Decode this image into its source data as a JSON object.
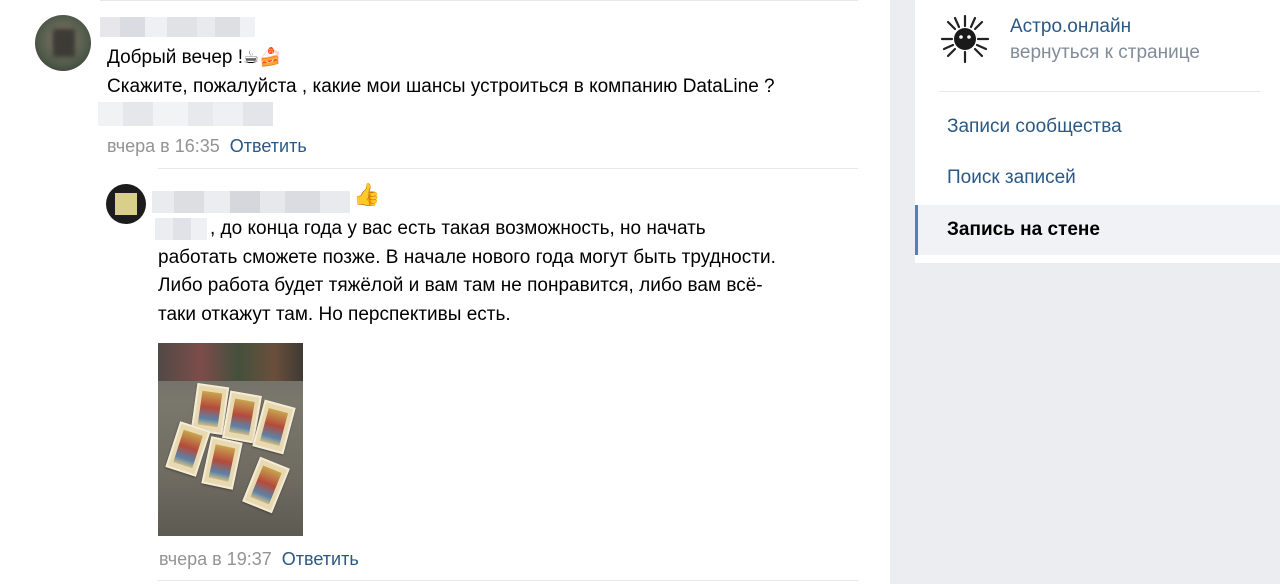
{
  "comment1": {
    "greeting": "Добрый вечер !",
    "greeting_emojis": "☕🍰",
    "question": "Скажите, пожалуйста , какие мои шансы устроиться в компанию DataLine ?",
    "time": "вчера в 16:35",
    "reply_label": "Ответить"
  },
  "comment2": {
    "thumb_emoji": "👍",
    "lines": [
      ", до конца года у вас есть такая возможность, но начать",
      "работать сможете позже. В начале нового года могут быть трудности.",
      "Либо работа будет тяжёлой и вам там не понравится, либо вам всё-",
      "таки откажут там. Но перспективы есть."
    ],
    "time": "вчера в 19:37",
    "reply_label": "Ответить"
  },
  "sidebar": {
    "community_name": "Астро.онлайн",
    "back_link": "вернуться к странице",
    "nav": [
      {
        "label": "Записи сообщества"
      },
      {
        "label": "Поиск записей"
      },
      {
        "label": "Запись на стене"
      }
    ],
    "active_index": 2,
    "accent_color": "#5181b8",
    "link_color": "#2a5885"
  }
}
